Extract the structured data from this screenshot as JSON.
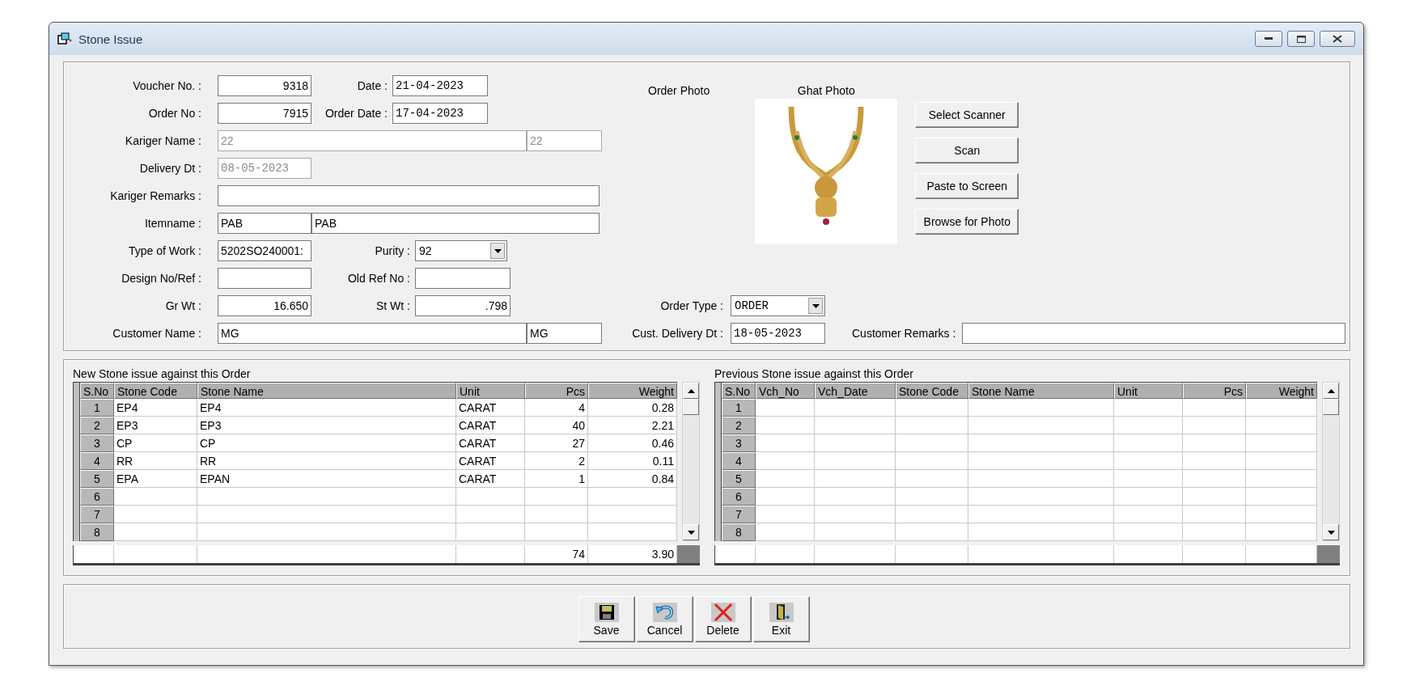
{
  "window": {
    "title": "Stone Issue"
  },
  "form": {
    "voucher_no": {
      "label": "Voucher No. :",
      "value": "9318"
    },
    "date": {
      "label": "Date :",
      "value": "21-04-2023"
    },
    "order_no": {
      "label": "Order No :",
      "value": "7915"
    },
    "order_date": {
      "label": "Order Date :",
      "value": "17-04-2023"
    },
    "kariger_name": {
      "label": "Kariger Name :",
      "values": [
        "22",
        "22"
      ],
      "disabled": true
    },
    "delivery_dt": {
      "label": "Delivery Dt :",
      "value": "08-05-2023",
      "disabled": true
    },
    "kariger_remarks": {
      "label": "Kariger Remarks :"
    },
    "itemname": {
      "label": "Itemname :",
      "values": [
        "PAB",
        "PAB"
      ]
    },
    "type_of_work": {
      "label": "Type of Work :",
      "value": "5202SO240001:"
    },
    "purity": {
      "label": "Purity :",
      "value": "92"
    },
    "design_no": {
      "label": "Design No/Ref :"
    },
    "old_ref_no": {
      "label": "Old Ref No :"
    },
    "gr_wt": {
      "label": "Gr Wt :",
      "value": "16.650"
    },
    "st_wt": {
      "label": "St Wt :",
      "value": ".798"
    },
    "order_type": {
      "label": "Order Type :",
      "value": "ORDER"
    },
    "customer_name": {
      "label": "Customer Name :",
      "values": [
        "MG",
        "MG"
      ]
    },
    "cust_delivery_dt": {
      "label": "Cust. Delivery Dt :",
      "value": "18-05-2023"
    },
    "customer_remarks": {
      "label": "Customer Remarks :"
    }
  },
  "photos": {
    "order_photo_label": "Order Photo",
    "ghat_photo_label": "Ghat Photo"
  },
  "photo_buttons": [
    "Select Scanner",
    "Scan",
    "Paste to Screen",
    "Browse for Photo"
  ],
  "grids": [
    {
      "title": "New Stone issue against this Order",
      "columns": [
        "S.No",
        "Stone Code",
        "Stone Name",
        "Unit",
        "Pcs",
        "Weight"
      ],
      "rows": [
        {
          "no": "1",
          "cells": [
            "EP4",
            "EP4",
            "CARAT",
            "4",
            "0.28"
          ]
        },
        {
          "no": "2",
          "cells": [
            "EP3",
            "EP3",
            "CARAT",
            "40",
            "2.21"
          ]
        },
        {
          "no": "3",
          "cells": [
            "CP",
            "CP",
            "CARAT",
            "27",
            "0.46"
          ]
        },
        {
          "no": "4",
          "cells": [
            "RR",
            "RR",
            "CARAT",
            "2",
            "0.11"
          ]
        },
        {
          "no": "5",
          "cells": [
            "EPA",
            "EPAN",
            "CARAT",
            "1",
            "0.84"
          ]
        },
        {
          "no": "6"
        },
        {
          "no": "7"
        },
        {
          "no": "8"
        }
      ],
      "totals": {
        "pcs": "74",
        "weight": "3.90"
      }
    },
    {
      "title": "Previous Stone issue against this Order",
      "columns": [
        "S.No",
        "Vch_No",
        "Vch_Date",
        "Stone Code",
        "Stone Name",
        "Unit",
        "Pcs",
        "Weight"
      ],
      "rows": [
        {
          "no": "1"
        },
        {
          "no": "2"
        },
        {
          "no": "3"
        },
        {
          "no": "4"
        },
        {
          "no": "5"
        },
        {
          "no": "6"
        },
        {
          "no": "7"
        },
        {
          "no": "8"
        }
      ]
    }
  ],
  "buttons": [
    {
      "kind": "save",
      "label": "Save"
    },
    {
      "kind": "cancel",
      "label": "Cancel"
    },
    {
      "kind": "delete",
      "label": "Delete"
    },
    {
      "kind": "exit",
      "label": "Exit"
    }
  ]
}
